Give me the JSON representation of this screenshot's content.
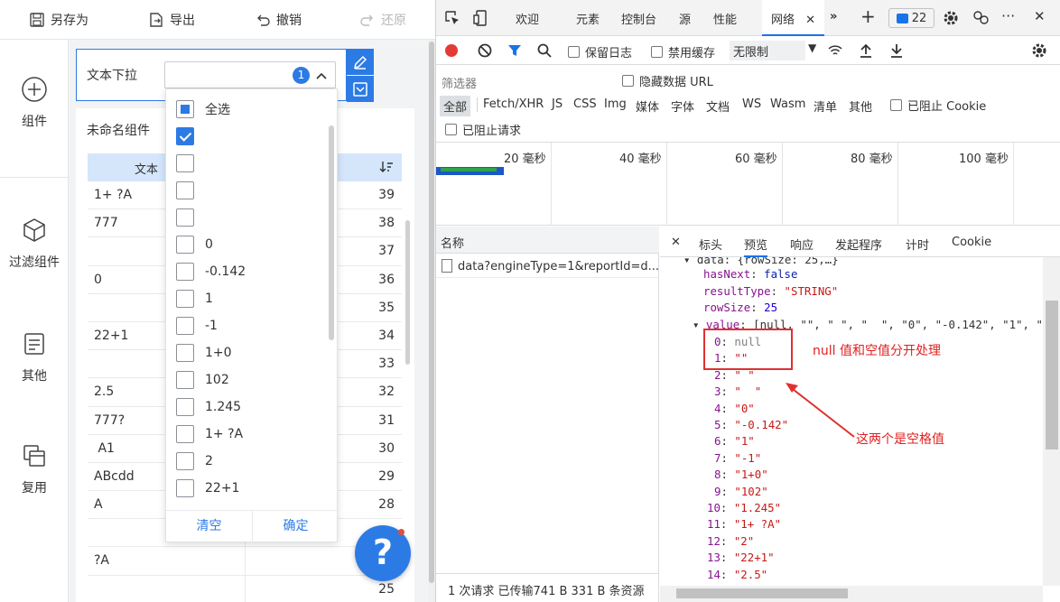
{
  "toolbar": {
    "save_as": "另存为",
    "export": "导出",
    "undo": "撤销",
    "redo": "还原"
  },
  "sidebar": {
    "items": [
      {
        "label": "组件",
        "icon": "add-circle-icon"
      },
      {
        "label": "过滤组件",
        "icon": "cube-icon"
      },
      {
        "label": "其他",
        "icon": "document-icon"
      },
      {
        "label": "复用",
        "icon": "copy-icon"
      }
    ]
  },
  "filter": {
    "label": "文本下拉",
    "selected_count": "1"
  },
  "table": {
    "title": "未命名组件",
    "header_text": "文本",
    "rows": [
      {
        "text": "1+ ?A",
        "num": "39"
      },
      {
        "text": "777",
        "num": "38"
      },
      {
        "text": "",
        "num": "37"
      },
      {
        "text": "0",
        "num": "36"
      },
      {
        "text": "",
        "num": "35"
      },
      {
        "text": "22+1",
        "num": "34"
      },
      {
        "text": "",
        "num": "33"
      },
      {
        "text": "2.5",
        "num": "32"
      },
      {
        "text": "777?",
        "num": "31"
      },
      {
        "text": " A1",
        "num": "30"
      },
      {
        "text": "ABcdd",
        "num": "29"
      },
      {
        "text": "A",
        "num": "28"
      },
      {
        "text": "",
        "num": ""
      },
      {
        "text": "?A",
        "num": ""
      },
      {
        "text": "",
        "num": "25"
      }
    ]
  },
  "dropdown": {
    "select_all": "全选",
    "options": [
      {
        "label": "",
        "checked": true
      },
      {
        "label": "",
        "checked": false
      },
      {
        "label": "",
        "checked": false
      },
      {
        "label": "",
        "checked": false
      },
      {
        "label": "0",
        "checked": false
      },
      {
        "label": "-0.142",
        "checked": false
      },
      {
        "label": "1",
        "checked": false
      },
      {
        "label": "-1",
        "checked": false
      },
      {
        "label": "1+0",
        "checked": false
      },
      {
        "label": "102",
        "checked": false
      },
      {
        "label": "1.245",
        "checked": false
      },
      {
        "label": "1+ ?A",
        "checked": false
      },
      {
        "label": "2",
        "checked": false
      },
      {
        "label": "22+1",
        "checked": false
      }
    ],
    "clear": "清空",
    "confirm": "确定"
  },
  "help": {
    "symbol": "?"
  },
  "devtools": {
    "tabs": [
      "欢迎",
      "元素",
      "控制台",
      "源",
      "性能",
      "网络"
    ],
    "active_tab": "网络",
    "message_count": "22",
    "tools": {
      "preserve_log": "保留日志",
      "disable_cache": "禁用缓存",
      "throttle": "无限制"
    },
    "filter": {
      "placeholder": "筛选器",
      "hide_data_urls": "隐藏数据 URL",
      "types": [
        "全部",
        "Fetch/XHR",
        "JS",
        "CSS",
        "Img",
        "媒体",
        "字体",
        "文档",
        "WS",
        "Wasm",
        "清单",
        "其他"
      ],
      "blocked_cookies": "已阻止 Cookie",
      "blocked_requests": "已阻止请求"
    },
    "timeline": [
      "20 毫秒",
      "40 毫秒",
      "60 毫秒",
      "80 毫秒",
      "100 毫秒"
    ],
    "requests": {
      "column_name": "名称",
      "row": "data?engineType=1&reportId=d...",
      "status": "1 次请求  已传输741 B  331 B 条资源"
    },
    "preview_tabs": [
      "标头",
      "预览",
      "响应",
      "发起程序",
      "计时",
      "Cookie"
    ],
    "active_preview_tab": "预览",
    "json": {
      "first": "▾ data: {rowSize: 25,…}",
      "has_next": "false",
      "result_type": "\"STRING\"",
      "row_size": "25",
      "value_summary": "[null, \"\", \" \", \"  \", \"0\", \"-0.142\", \"1\", \"-",
      "values": [
        "null",
        "\"\"",
        "\" \"",
        "\"  \"",
        "\"0\"",
        "\"-0.142\"",
        "\"1\"",
        "\"-1\"",
        "\"1+0\"",
        "\"102\"",
        "\"1.245\"",
        "\"1+ ?A\"",
        "\"2\"",
        "\"22+1\"",
        "\"2.5\""
      ]
    }
  },
  "annotations": {
    "null_note": "null 值和空值分开处理",
    "space_note": "这两个是空格值",
    "color": "#e02020"
  },
  "colors": {
    "accent": "#2c7be5",
    "devtools_accent": "#1a73e8",
    "record": "#e53935"
  }
}
